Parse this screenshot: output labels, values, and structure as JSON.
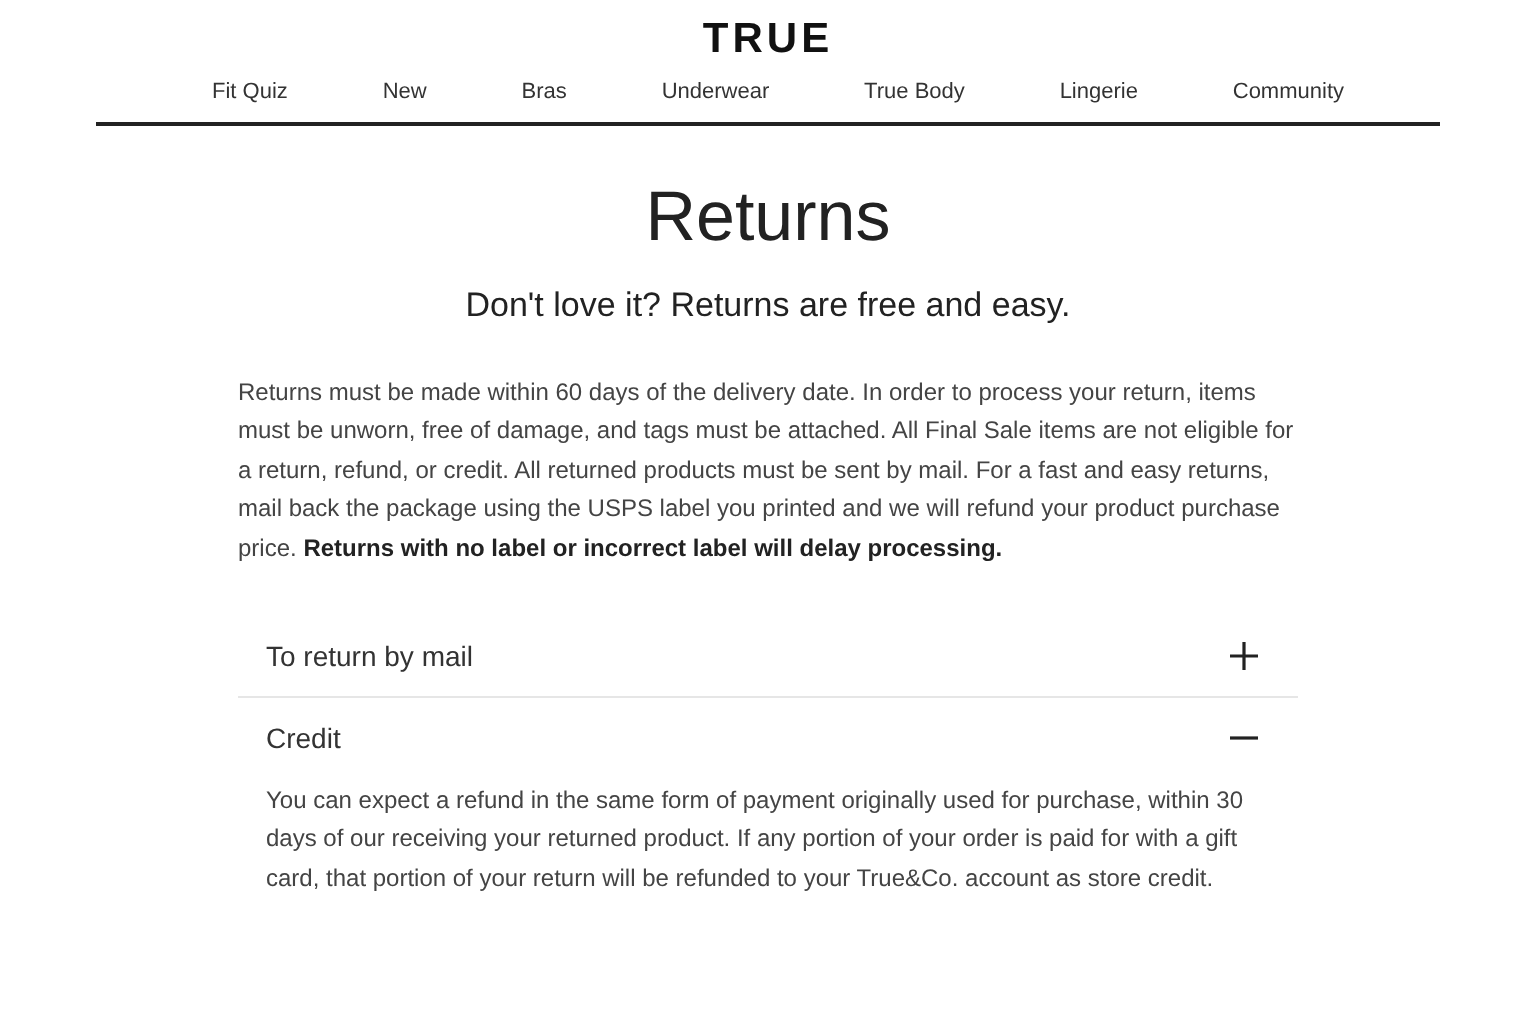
{
  "header": {
    "logo": "TRUE",
    "nav": [
      "Fit Quiz",
      "New",
      "Bras",
      "Underwear",
      "True Body",
      "Lingerie",
      "Community"
    ]
  },
  "page": {
    "title": "Returns",
    "subtitle": "Don't love it? Returns are free and easy.",
    "intro": "Returns must be made within 60 days of the delivery date. In order to process your return, items must be unworn, free of damage, and tags must be attached. All Final Sale items are not eligible for a return, refund, or credit. All returned products must be sent by mail. For a fast and easy returns, mail back the package using the USPS label you printed and we will refund your product purchase price. **Returns with no label or incorrect label will delay processing.**"
  },
  "accordion": [
    {
      "title": "To return by mail",
      "expanded": false
    },
    {
      "title": "Credit",
      "expanded": true,
      "body": "You can expect a refund in the same form of payment originally used for purchase, within 30 days of our receiving your returned product. If any portion of your order is paid for with a gift card, that portion of your return will be refunded to your True&Co. account as store credit."
    }
  ]
}
